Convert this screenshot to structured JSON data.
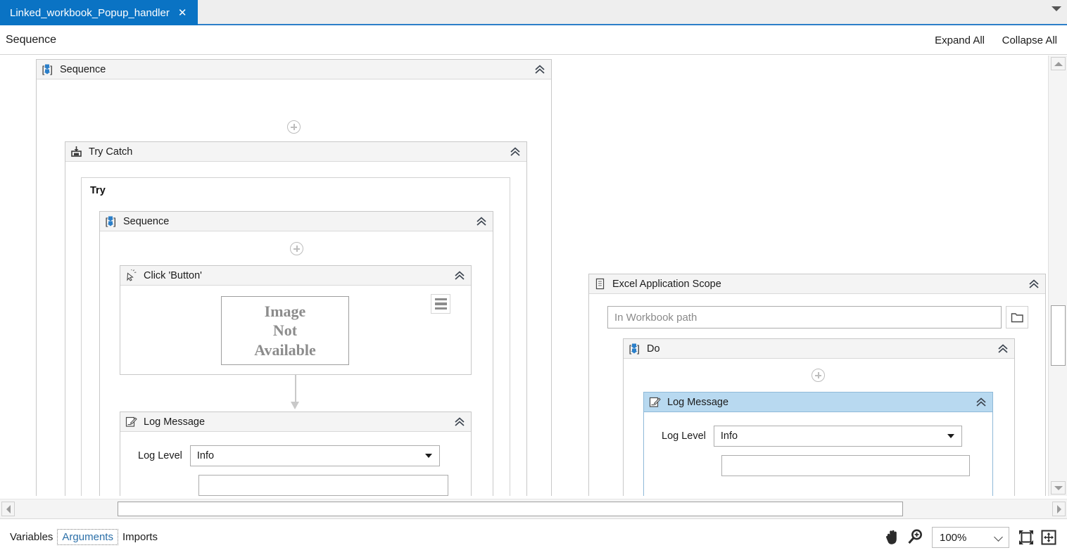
{
  "window": {
    "tab": {
      "label": "Linked_workbook_Popup_handler",
      "close": "✕"
    }
  },
  "breadcrumb": {
    "path": "Sequence"
  },
  "toolbar": {
    "expand_all": "Expand All",
    "collapse_all": "Collapse All"
  },
  "canvas": {
    "root_sequence": {
      "title": "Sequence",
      "icon": "sequence-icon"
    },
    "try_catch": {
      "title": "Try Catch",
      "icon": "try-catch-icon",
      "try_label": "Try"
    },
    "try_sequence": {
      "title": "Sequence",
      "icon": "sequence-icon"
    },
    "click_activity": {
      "title": "Click 'Button'",
      "icon": "click-icon",
      "image_placeholder_line1": "Image",
      "image_placeholder_line2": "Not",
      "image_placeholder_line3": "Available",
      "menu_icon": "hamburger-icon"
    },
    "log_message_left": {
      "title": "Log Message",
      "icon": "log-message-icon",
      "log_level_label": "Log Level",
      "log_level_value": "Info"
    },
    "excel_scope": {
      "title": "Excel Application Scope",
      "icon": "excel-scope-icon",
      "workbook_path_placeholder": "In Workbook path",
      "browse_icon": "folder-icon"
    },
    "do_block": {
      "title": "Do",
      "icon": "sequence-icon"
    },
    "log_message_right": {
      "title": "Log Message",
      "icon": "log-message-icon",
      "log_level_label": "Log Level",
      "log_level_value": "Info",
      "selected": true
    }
  },
  "statusbar": {
    "tabs": [
      {
        "label": "Variables",
        "active": false
      },
      {
        "label": "Arguments",
        "active": true
      },
      {
        "label": "Imports",
        "active": false
      }
    ],
    "pan_icon": "hand-icon",
    "zoom_icon": "magnifier-plus-icon",
    "zoom_level": "100%",
    "fit_icon": "fit-to-screen-icon",
    "overview_icon": "overview-icon"
  },
  "colors": {
    "accent": "#0a73c4",
    "selection": "#b8d9f0",
    "header_bg": "#f4f4f4",
    "border": "#c8c8c8"
  }
}
